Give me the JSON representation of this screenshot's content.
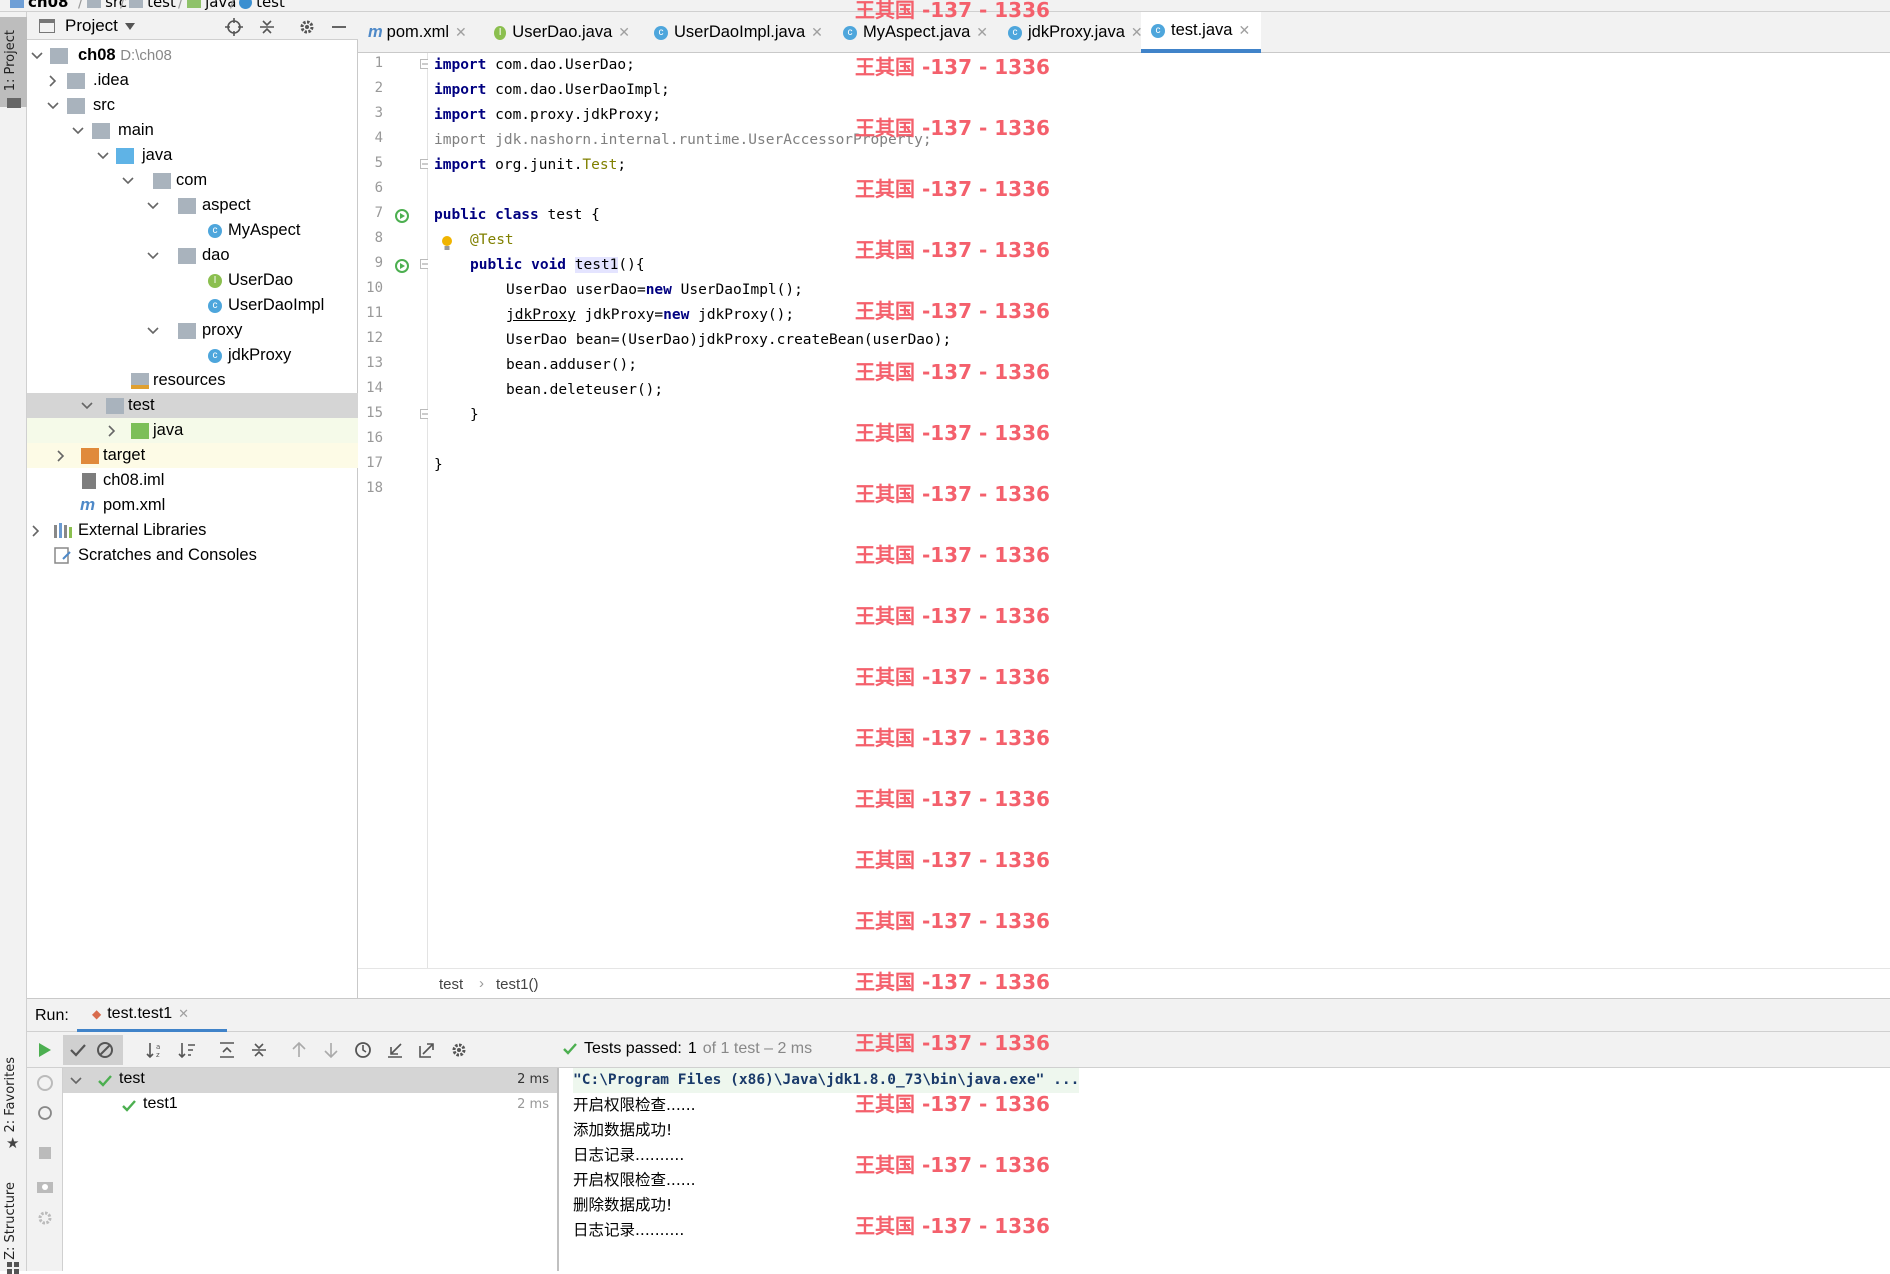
{
  "breadcrumb": [
    "ch08",
    "src",
    "test",
    "java",
    "test"
  ],
  "sidebar_tabs": {
    "project": "1: Project",
    "favorites": "2: Favorites",
    "structure": "Z: Structure"
  },
  "project_panel": {
    "title": "Project",
    "tree": [
      {
        "label": "ch08",
        "extra": "D:\\ch08"
      },
      {
        "label": ".idea"
      },
      {
        "label": "src"
      },
      {
        "label": "main"
      },
      {
        "label": "java"
      },
      {
        "label": "com"
      },
      {
        "label": "aspect"
      },
      {
        "label": "MyAspect"
      },
      {
        "label": "dao"
      },
      {
        "label": "UserDao"
      },
      {
        "label": "UserDaoImpl"
      },
      {
        "label": "proxy"
      },
      {
        "label": "jdkProxy"
      },
      {
        "label": "resources"
      },
      {
        "label": "test"
      },
      {
        "label": "java"
      },
      {
        "label": "target"
      },
      {
        "label": "ch08.iml"
      },
      {
        "label": "pom.xml"
      },
      {
        "label": "External Libraries"
      },
      {
        "label": "Scratches and Consoles"
      }
    ]
  },
  "tabs": [
    {
      "label": "pom.xml"
    },
    {
      "label": "UserDao.java"
    },
    {
      "label": "UserDaoImpl.java"
    },
    {
      "label": "MyAspect.java"
    },
    {
      "label": "jdkProxy.java"
    },
    {
      "label": "test.java",
      "active": true
    }
  ],
  "editor": {
    "line_numbers": [
      "1",
      "2",
      "3",
      "4",
      "5",
      "6",
      "7",
      "8",
      "9",
      "10",
      "11",
      "12",
      "13",
      "14",
      "15",
      "16",
      "17",
      "18"
    ],
    "lines": {
      "l1_kw": "import",
      "l1_rest": " com.dao.UserDao;",
      "l2_kw": "import",
      "l2_rest": " com.dao.UserDaoImpl;",
      "l3_kw": "import",
      "l3_rest": " com.proxy.jdkProxy;",
      "l4_kw": "import",
      "l4_rest": " jdk.nashorn.internal.runtime.UserAccessorProperty;",
      "l5_kw": "import",
      "l5_mid": " org.junit.",
      "l5_ann": "Test",
      "l5_end": ";",
      "l7_kw": "public class",
      "l7_rest": " test {",
      "l8_ann": "@Test",
      "l9_kw": "public void",
      "l9_name": "test1",
      "l9_rest": "(){",
      "l10_a": "UserDao userDao=",
      "l10_kw": "new",
      "l10_b": " UserDaoImpl();",
      "l11_a": "jdkProxy",
      "l11_b": " jdkProxy=",
      "l11_kw": "new",
      "l11_c": " jdkProxy();",
      "l12": "UserDao bean=(UserDao)jdkProxy.createBean(userDao);",
      "l13": "bean.adduser();",
      "l14": "bean.deleteuser();",
      "l15": "}",
      "l17": "}"
    },
    "breadcrumb": [
      "test",
      "test1()"
    ]
  },
  "run": {
    "label": "Run:",
    "tab": "test.test1",
    "status_prefix": "Tests passed:",
    "status_count": "1",
    "status_rest": "of 1 test – 2 ms",
    "tree": [
      {
        "label": "test",
        "time": "2 ms"
      },
      {
        "label": "test1",
        "time": "2 ms"
      }
    ],
    "console": [
      "\"C:\\Program Files (x86)\\Java\\jdk1.8.0_73\\bin\\java.exe\" ...",
      "开启权限检查......",
      "添加数据成功!",
      "日志记录..........",
      "开启权限检查......",
      "删除数据成功!",
      "日志记录.........."
    ]
  },
  "watermark": "王其国 -137 - 1336",
  "colors": {
    "accent": "#4083c9",
    "keyword": "#000080",
    "annotation": "#808000",
    "watermark": "#f4606c",
    "success": "#4caf50"
  }
}
